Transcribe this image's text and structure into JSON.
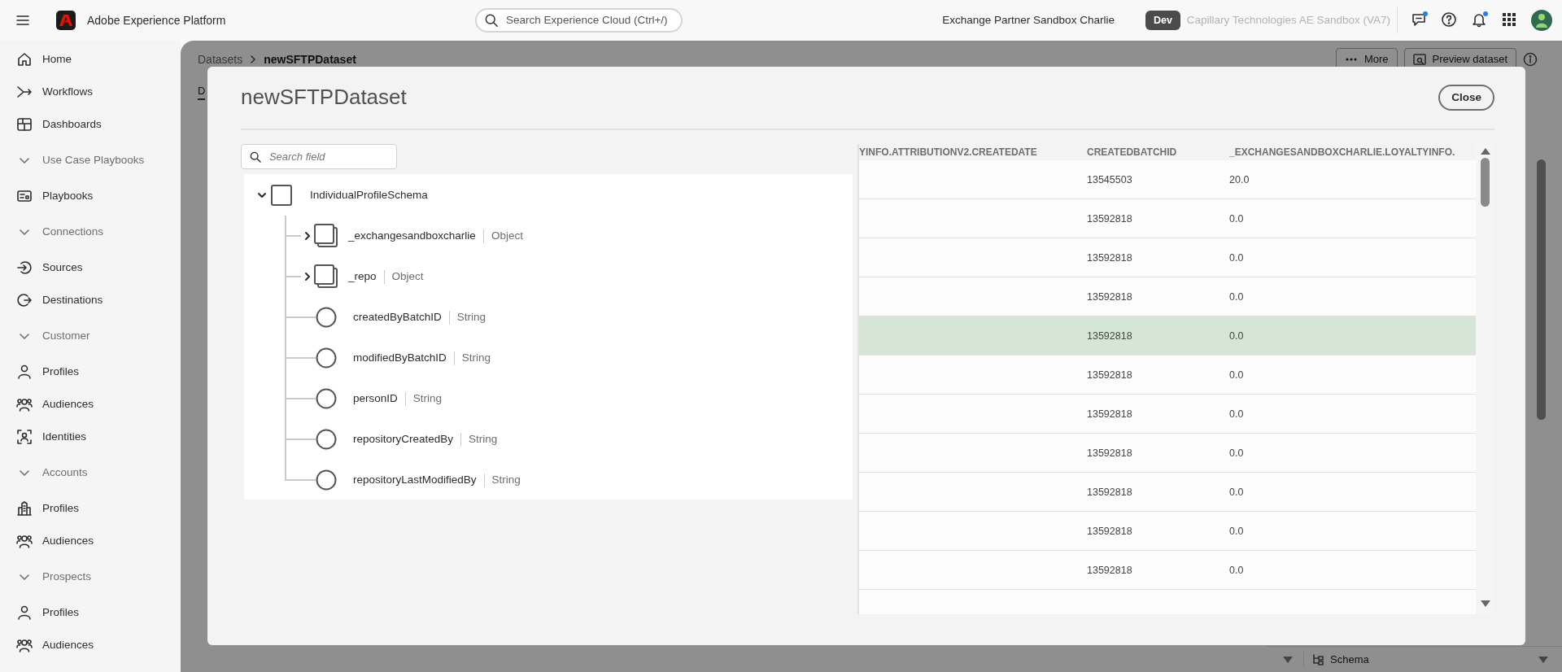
{
  "top_bar": {
    "app_name": "Adobe Experience Platform",
    "search": {
      "placeholder": "Search Experience Cloud (Ctrl+/)"
    },
    "sandbox": "Exchange Partner Sandbox Charlie",
    "environment_badge": "Dev",
    "organization": "Capillary Technologies AE Sandbox (VA7)",
    "actions": [
      {
        "notification": true
      },
      {
        "notification": false
      },
      {
        "notification": true
      },
      {
        "notification": false
      }
    ]
  },
  "sidebar": {
    "items": [
      {
        "kind": "link",
        "label": "Home"
      },
      {
        "kind": "link",
        "label": "Workflows"
      },
      {
        "kind": "link",
        "label": "Dashboards"
      },
      {
        "kind": "section",
        "label": "Use Case Playbooks",
        "expanded": true
      },
      {
        "kind": "link",
        "label": "Playbooks"
      },
      {
        "kind": "section",
        "label": "Connections",
        "expanded": true
      },
      {
        "kind": "link",
        "label": "Sources"
      },
      {
        "kind": "link",
        "label": "Destinations"
      },
      {
        "kind": "section",
        "label": "Customer",
        "expanded": true
      },
      {
        "kind": "link",
        "label": "Profiles"
      },
      {
        "kind": "link",
        "label": "Audiences"
      },
      {
        "kind": "link",
        "label": "Identities"
      },
      {
        "kind": "section",
        "label": "Accounts",
        "expanded": true
      },
      {
        "kind": "link",
        "label": "Profiles"
      },
      {
        "kind": "link",
        "label": "Audiences"
      },
      {
        "kind": "section",
        "label": "Prospects",
        "expanded": true
      },
      {
        "kind": "link",
        "label": "Profiles"
      },
      {
        "kind": "link",
        "label": "Audiences"
      }
    ]
  },
  "page": {
    "breadcrumb": [
      "Datasets",
      "newSFTPDataset"
    ],
    "buttons": [
      "More",
      "Preview dataset"
    ],
    "tab": "D",
    "panel_label": "Schema"
  },
  "modal": {
    "title": "newSFTPDataset",
    "close_button": "Close",
    "search": {
      "placeholder": "Search field"
    },
    "tree": {
      "kind": "root",
      "name": "IndividualProfileSchema",
      "expanded": true,
      "children": [
        {
          "kind": "object",
          "name": "_exchangesandboxcharlie",
          "type": "Object",
          "expanded": false
        },
        {
          "kind": "object",
          "name": "_repo",
          "type": "Object",
          "expanded": false
        },
        {
          "kind": "field",
          "name": "createdByBatchID",
          "type": "String"
        },
        {
          "kind": "field",
          "name": "modifiedByBatchID",
          "type": "String"
        },
        {
          "kind": "field",
          "name": "personID",
          "type": "String"
        },
        {
          "kind": "field",
          "name": "repositoryCreatedBy",
          "type": "String"
        },
        {
          "kind": "field",
          "name": "repositoryLastModifiedBy",
          "type": "String"
        }
      ]
    },
    "table": {
      "columns": [
        "YINFO.ATTRIBUTIONV2.CREATEDATE",
        "CREATEDBATCHID",
        "_EXCHANGESANDBOXCHARLIE.LOYALTYINFO."
      ],
      "rows": [
        {
          "cells": [
            "",
            "13545503",
            "20.0"
          ],
          "hovered": false
        },
        {
          "cells": [
            "",
            "13592818",
            "0.0"
          ],
          "hovered": false
        },
        {
          "cells": [
            "",
            "13592818",
            "0.0"
          ],
          "hovered": false
        },
        {
          "cells": [
            "",
            "13592818",
            "0.0"
          ],
          "hovered": false
        },
        {
          "cells": [
            "",
            "13592818",
            "0.0"
          ],
          "hovered": true
        },
        {
          "cells": [
            "",
            "13592818",
            "0.0"
          ],
          "hovered": false
        },
        {
          "cells": [
            "",
            "13592818",
            "0.0"
          ],
          "hovered": false
        },
        {
          "cells": [
            "",
            "13592818",
            "0.0"
          ],
          "hovered": false
        },
        {
          "cells": [
            "",
            "13592818",
            "0.0"
          ],
          "hovered": false
        },
        {
          "cells": [
            "",
            "13592818",
            "0.0"
          ],
          "hovered": false
        },
        {
          "cells": [
            "",
            "13592818",
            "0.0"
          ],
          "hovered": false
        }
      ]
    }
  }
}
